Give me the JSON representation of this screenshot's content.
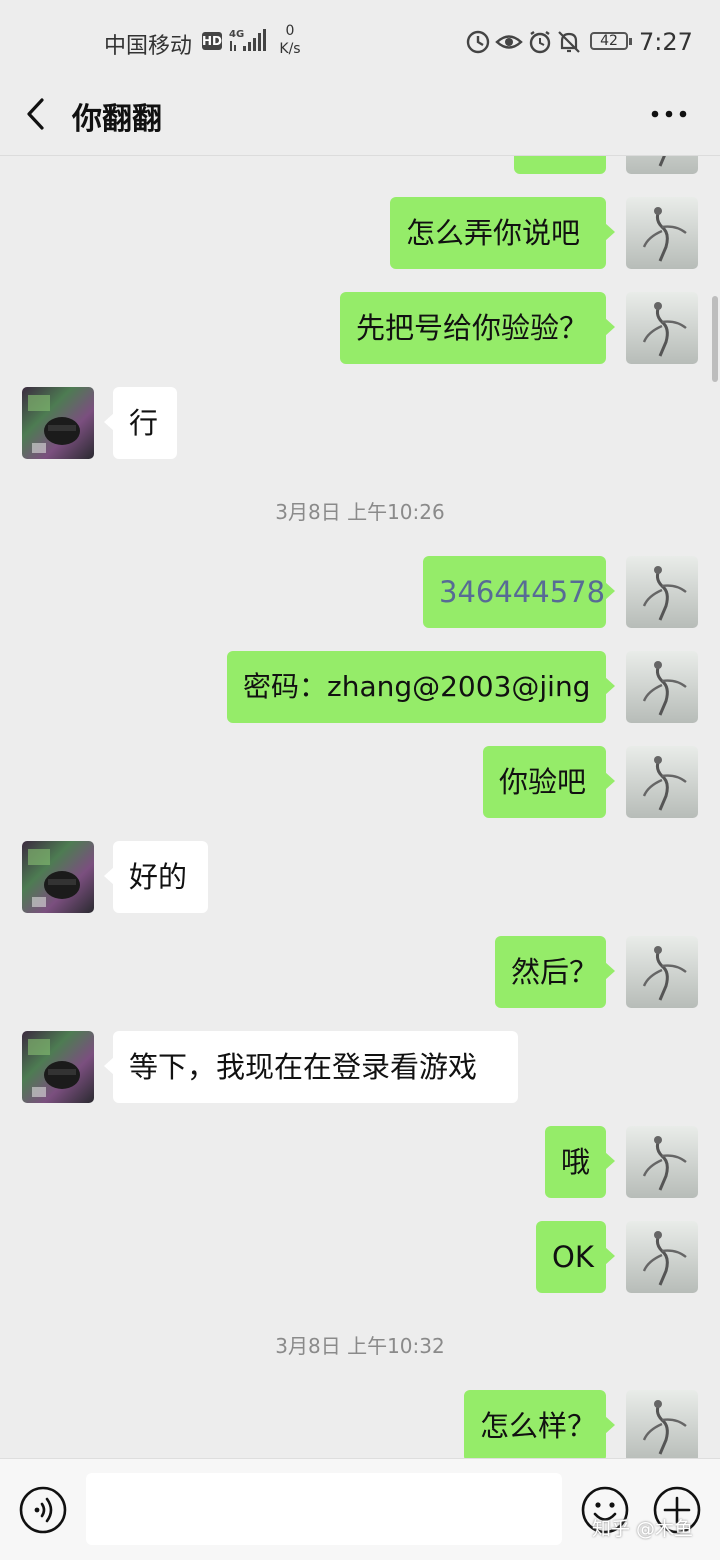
{
  "status_bar": {
    "carrier": "中国移动",
    "hd": "HD",
    "net_speed_value": "0",
    "net_speed_unit": "K/s",
    "battery": "42",
    "time": "7:27"
  },
  "header": {
    "title": "你翻翻",
    "back_icon": "chevron-left-icon",
    "more_icon": "more-dots-icon"
  },
  "messages": [
    {
      "from": "me",
      "text": "怎么弄你说吧"
    },
    {
      "from": "me",
      "text": "先把号给你验验？"
    },
    {
      "from": "them",
      "text": "行"
    },
    {
      "timestamp": "3月8日 上午10:26"
    },
    {
      "from": "me",
      "text": "346444578"
    },
    {
      "from": "me",
      "text": "密码：zhang@2003@jing"
    },
    {
      "from": "me",
      "text": "你验吧"
    },
    {
      "from": "them",
      "text": "好的"
    },
    {
      "from": "me",
      "text": "然后？"
    },
    {
      "from": "them",
      "text": "等下，我现在在登录看游戏"
    },
    {
      "from": "me",
      "text": "哦"
    },
    {
      "from": "me",
      "text": "OK"
    },
    {
      "timestamp": "3月8日 上午10:32"
    },
    {
      "from": "me",
      "text": "怎么样？"
    }
  ],
  "input_bar": {
    "voice_icon": "voice-icon",
    "emoji_icon": "emoji-icon",
    "plus_icon": "plus-icon",
    "input_value": ""
  },
  "watermark": "知乎 @木鱼",
  "colors": {
    "background": "#ededed",
    "my_bubble": "#95ec69",
    "their_bubble": "#ffffff",
    "number_link": "#576b95"
  }
}
